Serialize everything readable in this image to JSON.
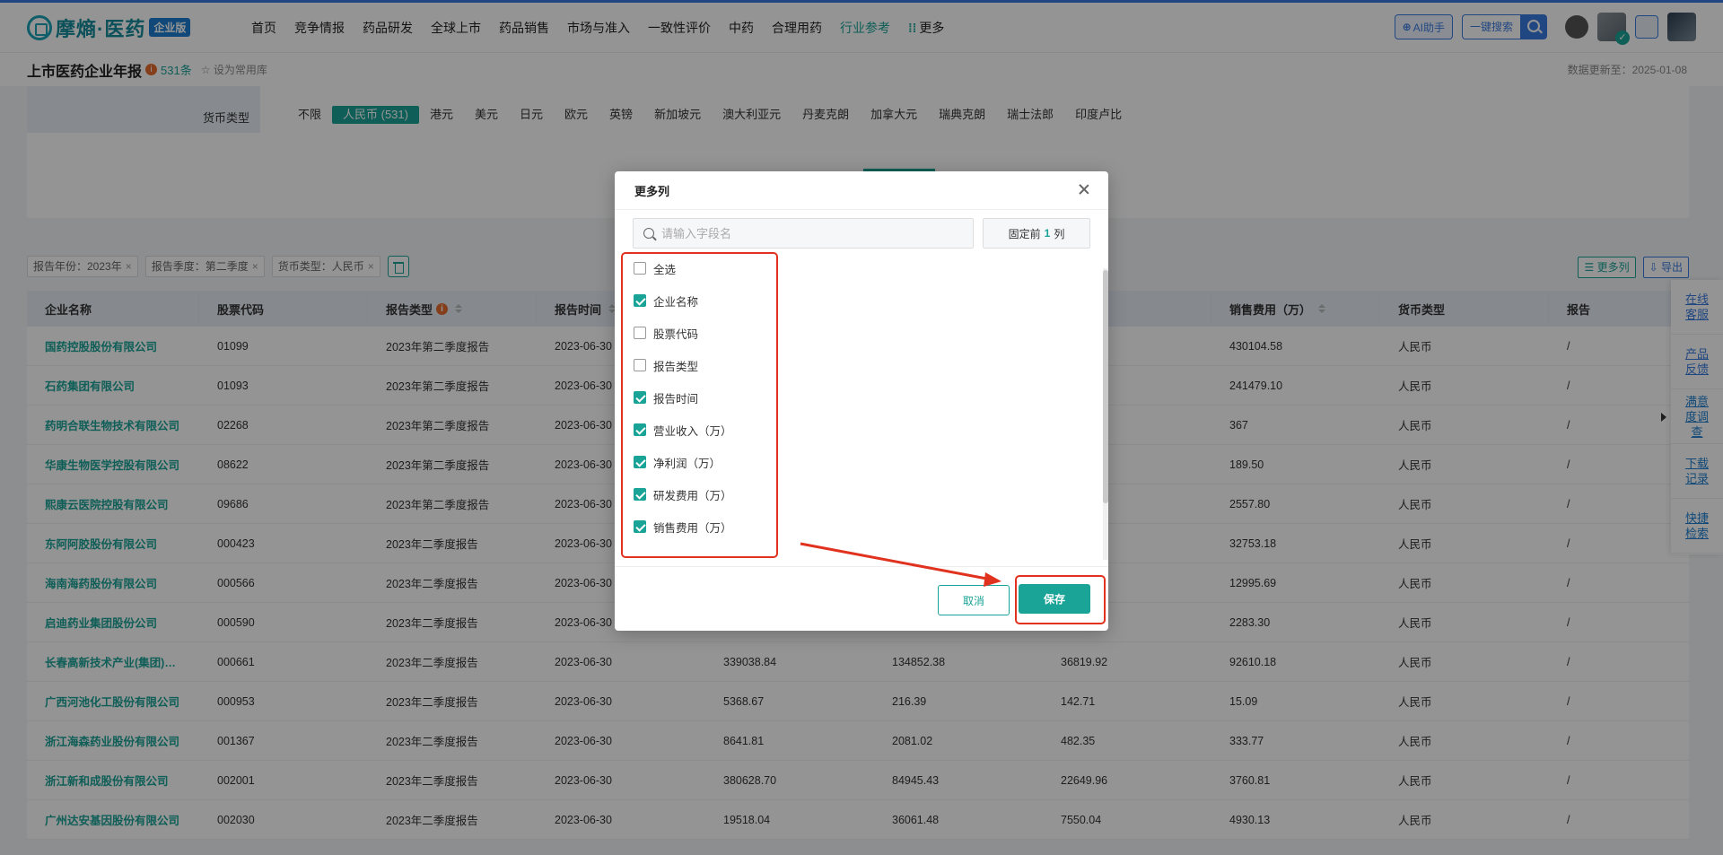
{
  "app": {
    "brand": "摩熵·医药",
    "edition": "企业版"
  },
  "nav": [
    "首页",
    "竞争情报",
    "药品研发",
    "全球上市",
    "药品销售",
    "市场与准入",
    "一致性评价",
    "中药",
    "合理用药",
    "行业参考",
    "更多"
  ],
  "nav_active": "行业参考",
  "top_right": {
    "ai_label": "AI助手",
    "search_label": "一键搜索"
  },
  "subheader": {
    "title": "上市医药企业年报",
    "count": "531条",
    "favorite": "设为常用库",
    "update": "数据更新至：2025-01-08"
  },
  "filter": {
    "label": "货币类型",
    "options": [
      "不限",
      "人民币 (531)",
      "港元",
      "美元",
      "日元",
      "欧元",
      "英镑",
      "新加坡元",
      "澳大利亚元",
      "丹麦克朗",
      "加拿大元",
      "瑞典克朗",
      "瑞士法郎",
      "印度卢比"
    ],
    "selected": "人民币 (531)"
  },
  "tags": [
    "报告年份：2023年",
    "报告季度：第二季度",
    "货币类型：人民币"
  ],
  "tools": {
    "more_cols": "更多列",
    "export": "导出"
  },
  "table": {
    "headers": [
      "企业名称",
      "股票代码",
      "报告类型",
      "报告时间",
      "",
      "",
      "(万)",
      "销售费用（万）",
      "货币类型",
      "报告"
    ],
    "rows": [
      [
        "国药控股股份有限公司",
        "01099",
        "2023年第二季度报告",
        "2023-06-30",
        "",
        "",
        "",
        "430104.58",
        "人民币",
        "/"
      ],
      [
        "石药集团有限公司",
        "01093",
        "2023年第二季度报告",
        "2023-06-30",
        "",
        "",
        "",
        "241479.10",
        "人民币",
        "/"
      ],
      [
        "药明合联生物技术有限公司",
        "02268",
        "2023年第二季度报告",
        "2023-06-30",
        "",
        "",
        "",
        "367",
        "人民币",
        "/"
      ],
      [
        "华康生物医学控股有限公司",
        "08622",
        "2023年第二季度报告",
        "2023-06-30",
        "",
        "",
        "",
        "189.50",
        "人民币",
        "/"
      ],
      [
        "熙康云医院控股有限公司",
        "09686",
        "2023年第二季度报告",
        "2023-06-30",
        "",
        "",
        "",
        "2557.80",
        "人民币",
        "/"
      ],
      [
        "东阿阿胶股份有限公司",
        "000423",
        "2023年二季度报告",
        "2023-06-30",
        "",
        "",
        "",
        "32753.18",
        "人民币",
        "/"
      ],
      [
        "海南海药股份有限公司",
        "000566",
        "2023年二季度报告",
        "2023-06-30",
        "",
        "",
        "",
        "12995.69",
        "人民币",
        "/"
      ],
      [
        "启迪药业集团股份公司",
        "000590",
        "2023年二季度报告",
        "2023-06-30",
        "",
        "",
        "",
        "2283.30",
        "人民币",
        "/"
      ],
      [
        "长春高新技术产业(集团)…",
        "000661",
        "2023年二季度报告",
        "2023-06-30",
        "339038.84",
        "134852.38",
        "36819.92",
        "92610.18",
        "人民币",
        "/"
      ],
      [
        "广西河池化工股份有限公司",
        "000953",
        "2023年二季度报告",
        "2023-06-30",
        "5368.67",
        "216.39",
        "142.71",
        "15.09",
        "人民币",
        "/"
      ],
      [
        "浙江海森药业股份有限公司",
        "001367",
        "2023年二季度报告",
        "2023-06-30",
        "8641.81",
        "2081.02",
        "482.35",
        "333.77",
        "人民币",
        "/"
      ],
      [
        "浙江新和成股份有限公司",
        "002001",
        "2023年二季度报告",
        "2023-06-30",
        "380628.70",
        "84945.43",
        "22649.96",
        "3760.81",
        "人民币",
        "/"
      ],
      [
        "广州达安基因股份有限公司",
        "002030",
        "2023年二季度报告",
        "2023-06-30",
        "19518.04",
        "36061.48",
        "7550.04",
        "4930.13",
        "人民币",
        "/"
      ]
    ]
  },
  "float_panel": [
    "在线客服",
    "产品反馈",
    "满意度调查",
    "下载记录",
    "快捷检索"
  ],
  "modal": {
    "title": "更多列",
    "search_placeholder": "请输入字段名",
    "fix_prefix": "固定前",
    "fix_num": "1",
    "fix_suffix": "列",
    "items": [
      {
        "label": "全选",
        "checked": false
      },
      {
        "label": "企业名称",
        "checked": true
      },
      {
        "label": "股票代码",
        "checked": false
      },
      {
        "label": "报告类型",
        "checked": false
      },
      {
        "label": "报告时间",
        "checked": true
      },
      {
        "label": "营业收入（万）",
        "checked": true
      },
      {
        "label": "净利润（万）",
        "checked": true
      },
      {
        "label": "研发费用（万）",
        "checked": true
      },
      {
        "label": "销售费用（万）",
        "checked": true
      }
    ],
    "cancel": "取消",
    "save": "保存"
  },
  "colors": {
    "accent": "#1aa397",
    "nav_blue": "#3a7be0",
    "annotation_red": "#e0321f"
  }
}
